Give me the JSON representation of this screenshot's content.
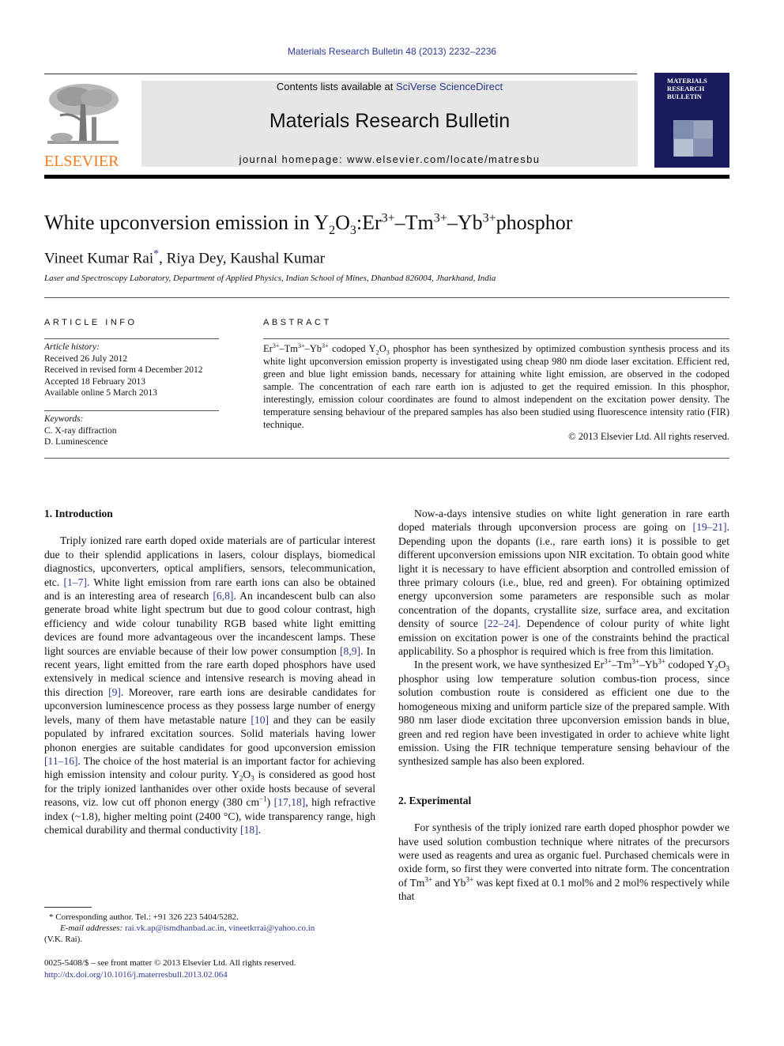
{
  "header": {
    "journal_ref": "Materials Research Bulletin 48 (2013) 2232–2236",
    "contents_prefix": "Contents lists available at ",
    "contents_link": "SciVerse ScienceDirect",
    "journal_title": "Materials Research Bulletin",
    "homepage": "journal homepage: www.elsevier.com/locate/matresbu",
    "publisher_logo_text": "ELSEVIER",
    "cover_title_lines": [
      "MATERIALS",
      "RESEARCH",
      "BULLETIN"
    ],
    "colors": {
      "link": "#2b3990",
      "elsevier_orange": "#f47b20",
      "cover_bg": "#1a1a5e",
      "header_box": "#e6e6e6"
    }
  },
  "article": {
    "title_parts": {
      "pre": "White upconversion emission in Y",
      "sub1": "2",
      "mid1": "O",
      "sub2": "3",
      "mid2": ":Er",
      "sup1": "3+",
      "mid3": "–Tm",
      "sup2": "3+",
      "mid4": "–Yb",
      "sup3": "3+",
      "post": "phosphor"
    },
    "authors": {
      "first": "Vineet Kumar Rai",
      "star": "*",
      "rest": ", Riya Dey, Kaushal Kumar"
    },
    "affiliation": "Laser and Spectroscopy Laboratory, Department of Applied Physics, Indian School of Mines, Dhanbad 826004, Jharkhand, India"
  },
  "article_info": {
    "heading": "ARTICLE INFO",
    "history_label": "Article history:",
    "history": [
      "Received 26 July 2012",
      "Received in revised form 4 December 2012",
      "Accepted 18 February 2013",
      "Available online 5 March 2013"
    ],
    "keywords_label": "Keywords:",
    "keywords": [
      "C. X-ray diffraction",
      "D. Luminescence"
    ]
  },
  "abstract": {
    "heading": "ABSTRACT",
    "lead": {
      "er": "Er",
      "s1": "3+",
      "tm": "–Tm",
      "s2": "3+",
      "yb": "–Yb",
      "s3": "3+",
      "codoped": " codoped Y",
      "b1": "2",
      "o": "O",
      "b2": "3"
    },
    "text": " phosphor has been synthesized by optimized combustion synthesis process and its white light upconversion emission property is investigated using cheap 980 nm diode laser excitation. Efficient red, green and blue light emission bands, necessary for attaining white light emission, are observed in the codoped sample. The concentration of each rare earth ion is adjusted to get the required emission. In this phosphor, interestingly, emission colour coordinates are found to almost independent on the excitation power density. The temperature sensing behaviour of the prepared samples has also been studied using fluorescence intensity ratio (FIR) technique.",
    "copyright": "© 2013 Elsevier Ltd. All rights reserved."
  },
  "intro": {
    "heading": "1.  Introduction",
    "p1": [
      "Triply ionized rare earth doped oxide materials are of particular interest due to their splendid applications in lasers, colour displays, biomedical diagnostics, upconverters, optical amplifiers, sensors, telecommunication, etc. ",
      "[1–7]",
      ". White light emission from rare earth ions can also be obtained and is an interesting area of research ",
      "[6,8]",
      ". An incandescent bulb can also generate broad white light spectrum but due to good colour contrast, high efficiency and wide colour tunability RGB based white light emitting devices are found more advantageous over the incandescent lamps. These light sources are enviable because of their low power consumption ",
      "[8,9]",
      ". In recent years, light emitted from the rare earth doped phosphors have used extensively in medical science and intensive research is moving ahead in this direction ",
      "[9]",
      ". Moreover, rare earth ions are desirable candidates for upconversion luminescence process as they possess large number of energy levels, many of them have metastable nature ",
      "[10]",
      " and they can be easily populated by infrared excitation sources. Solid materials having lower phonon energies are suitable candidates for good upconversion emission ",
      "[11–16]",
      ". The choice of the host material is an important factor for achieving high emission intensity and colour purity. Y",
      "2",
      "O",
      "3",
      " is considered as good host for the triply ionized lanthanides over other oxide hosts because of several reasons, viz. low cut off phonon energy (380 cm",
      "−1",
      ") ",
      "[17,18]",
      ", high refractive index (~1.8), higher melting point (2400 °C), wide transparency range, high chemical durability and thermal conductivity ",
      "[18]",
      "."
    ],
    "p2": [
      "Now-a-days intensive studies on white light generation in rare earth doped materials through upconversion process are going on ",
      "[19–21]",
      ". Depending upon the dopants (i.e., rare earth ions) it is possible to get different upconversion emissions upon NIR excitation. To obtain good white light it is necessary to have efficient absorption and controlled emission of three primary colours (i.e., blue, red and green). For obtaining optimized energy upconversion some parameters are responsible such as molar concentration of the dopants, crystallite size, surface area, and excitation density of source ",
      "[22–24]",
      ". Dependence of colour purity of white light emission on excitation power is one of the constraints behind the practical applicability. So a phosphor is required which is free from this limitation."
    ],
    "p3": [
      "In the present work, we have synthesized Er",
      "3+",
      "–Tm",
      "3+",
      "–Yb",
      "3+",
      " codoped Y",
      "2",
      "O",
      "3",
      " phosphor using low temperature solution combus-tion process, since solution combustion route is considered as efficient one due to the homogeneous mixing and uniform particle size of the prepared sample. With 980 nm laser diode excitation three upconversion emission bands in blue, green and red region have been investigated in order to achieve white light emission. Using the FIR technique temperature sensing behaviour of the synthesized sample has also been explored."
    ]
  },
  "experimental": {
    "heading": "2.  Experimental",
    "p1": [
      "For synthesis of the triply ionized rare earth doped phosphor powder we have used solution combustion technique where nitrates of the precursors were used as reagents and urea as organic fuel. Purchased chemicals were in oxide form, so first they were converted into nitrate form. The concentration of Tm",
      "3+",
      " and Yb",
      "3+",
      " was kept fixed at 0.1 mol% and 2 mol% respectively while that"
    ]
  },
  "footnotes": {
    "corresponding": "* Corresponding author. Tel.: +91 326 223 5404/5282.",
    "email_label": "E-mail addresses: ",
    "email1": "rai.vk.ap@ismdhanbad.ac.in",
    "email_sep": ", ",
    "email2": "vineetkrrai@yahoo.co.in",
    "email_owner": "(V.K. Rai).",
    "issn_line": "0025-5408/$ – see front matter © 2013 Elsevier Ltd. All rights reserved.",
    "doi": "http://dx.doi.org/10.1016/j.materresbull.2013.02.064"
  }
}
